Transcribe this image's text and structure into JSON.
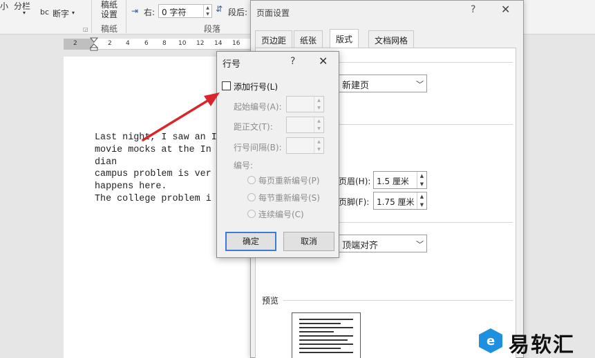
{
  "ribbon": {
    "small_label": "小",
    "columns": "分栏",
    "hyphenation_prefix": "bc",
    "hyphenation": "断字",
    "manuscript_line1": "稿纸",
    "manuscript_line2": "设置",
    "group_manuscript": "稿纸",
    "indent_right_label": "右:",
    "indent_right_value": "0 字符",
    "spacing_after_label": "段后:",
    "group_paragraph": "段落"
  },
  "ruler": {
    "ticks": [
      "2",
      "2",
      "4",
      "6",
      "8",
      "10",
      "12",
      "14",
      "16"
    ]
  },
  "document": {
    "lines": [
      "Last night, I saw an In",
      "movie mocks at the In",
      "dian",
      "campus problem is ver",
      "happens here.",
      "The college problem i"
    ]
  },
  "page_setup": {
    "title": "页面设置",
    "help": "?",
    "close": "✕",
    "tabs": [
      "页边距",
      "纸张",
      "版式",
      "文档网格"
    ],
    "active_tab": 2,
    "section_start_value": "新建页",
    "header_label": "页眉(H):",
    "header_value": "1.5 厘米",
    "footer_label": "页脚(F):",
    "footer_value": "1.75 厘米",
    "vertical_align_value": "顶端对齐",
    "preview_label": "预览"
  },
  "line_numbers": {
    "title": "行号",
    "help": "?",
    "close": "✕",
    "add_checkbox_label": "添加行号(L)",
    "add_checked": false,
    "start_label": "起始编号(A):",
    "from_text_label": "距正文(T):",
    "count_by_label": "行号间隔(B):",
    "numbering_label": "编号:",
    "restart_page": "每页重新编号(P)",
    "restart_section": "每节重新编号(S)",
    "continuous": "连续编号(C)",
    "ok": "确定",
    "cancel": "取消"
  },
  "watermark": {
    "badge": "e",
    "text": "易软汇"
  },
  "colors": {
    "arrow": "#d9262b",
    "accent": "#3a7bd5",
    "brand": "#1f8fe0"
  }
}
